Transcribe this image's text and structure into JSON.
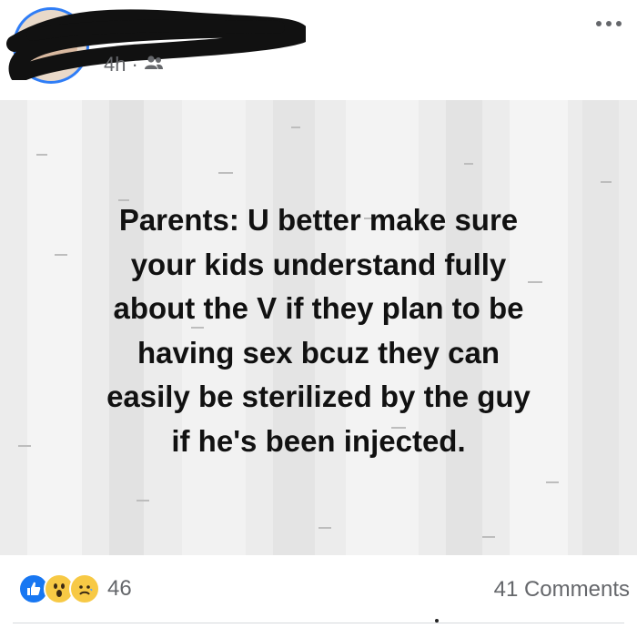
{
  "post": {
    "timestamp": "4h",
    "separator": "·",
    "audience_icon": "friends-icon",
    "more_icon": "more-options-icon",
    "image_text": "Parents: U better make sure\nyour kids understand fully\nabout the V if they plan to be\nhaving sex bcuz they can\neasily be sterilized by the guy\nif he's been injected.",
    "reactions": {
      "icons": [
        "like-icon",
        "wow-icon",
        "sad-icon"
      ],
      "count": "46"
    },
    "comments": "41 Comments"
  },
  "colors": {
    "accent": "#1877f2",
    "meta_text": "#65676b",
    "image_bg": "#ececec"
  }
}
